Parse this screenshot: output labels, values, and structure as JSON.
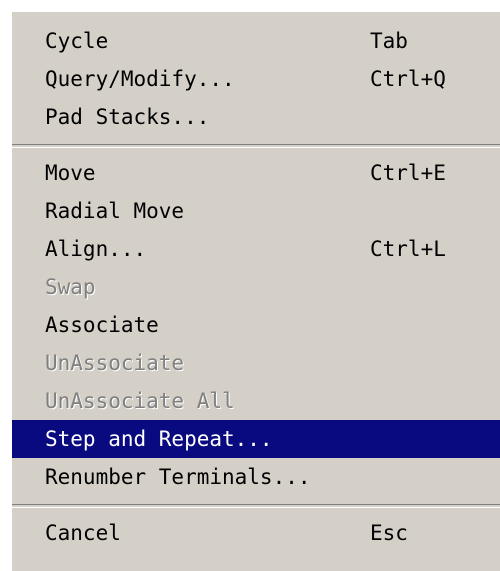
{
  "menu": {
    "items": [
      {
        "label": "Cycle",
        "shortcut": "Tab"
      },
      {
        "label": "Query/Modify...",
        "shortcut": "Ctrl+Q"
      },
      {
        "label": "Pad Stacks...",
        "shortcut": ""
      },
      {
        "label": "Move",
        "shortcut": "Ctrl+E"
      },
      {
        "label": "Radial Move",
        "shortcut": ""
      },
      {
        "label": "Align...",
        "shortcut": "Ctrl+L"
      },
      {
        "label": "Swap",
        "shortcut": "",
        "disabled": true
      },
      {
        "label": "Associate",
        "shortcut": ""
      },
      {
        "label": "UnAssociate",
        "shortcut": "",
        "disabled": true
      },
      {
        "label": "UnAssociate All",
        "shortcut": "",
        "disabled": true
      },
      {
        "label": "Step and Repeat...",
        "shortcut": "",
        "highlighted": true
      },
      {
        "label": "Renumber Terminals...",
        "shortcut": ""
      },
      {
        "label": "Cancel",
        "shortcut": "Esc"
      }
    ]
  },
  "colors": {
    "menu_background": "#d4d0c8",
    "highlight": "#0a0a80",
    "disabled_text": "#808080"
  }
}
